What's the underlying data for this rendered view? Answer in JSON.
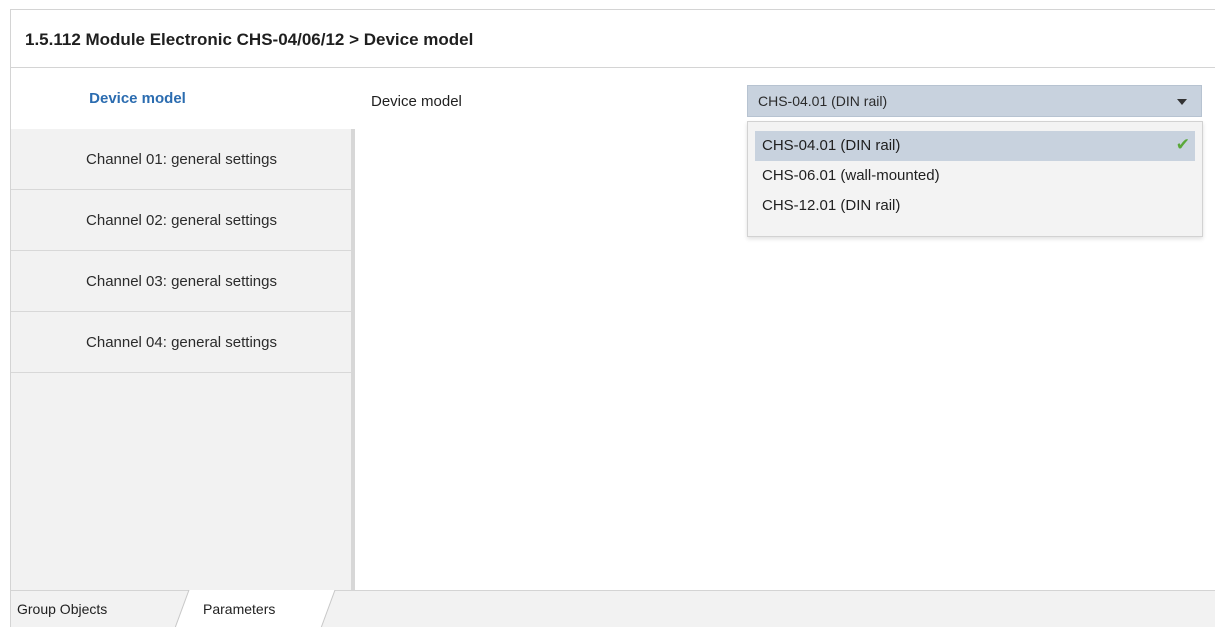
{
  "header": {
    "title": "1.5.112 Module Electronic CHS-04/06/12 > Device model"
  },
  "sidebar": {
    "items": [
      {
        "label": "Device model",
        "active": true
      },
      {
        "label": "Channel 01: general settings",
        "active": false
      },
      {
        "label": "Channel 02: general settings",
        "active": false
      },
      {
        "label": "Channel 03: general settings",
        "active": false
      },
      {
        "label": "Channel 04: general settings",
        "active": false
      }
    ]
  },
  "main": {
    "field_label": "Device model",
    "select": {
      "value": "CHS-04.01 (DIN rail)",
      "expanded": true,
      "options": [
        {
          "label": "CHS-04.01 (DIN rail)",
          "selected": true
        },
        {
          "label": "CHS-06.01 (wall-mounted)",
          "selected": false
        },
        {
          "label": "CHS-12.01 (DIN rail)",
          "selected": false
        }
      ]
    }
  },
  "bottom_tabs": [
    {
      "label": "Group Objects",
      "active": false
    },
    {
      "label": "Parameters",
      "active": true
    }
  ],
  "icons": {
    "selected_option": "check-icon",
    "select_toggle": "dropdown-arrow-icon"
  },
  "colors": {
    "accent_text": "#2b6cb0",
    "selection_bg": "#c8d2de",
    "check": "#5aa83a"
  }
}
